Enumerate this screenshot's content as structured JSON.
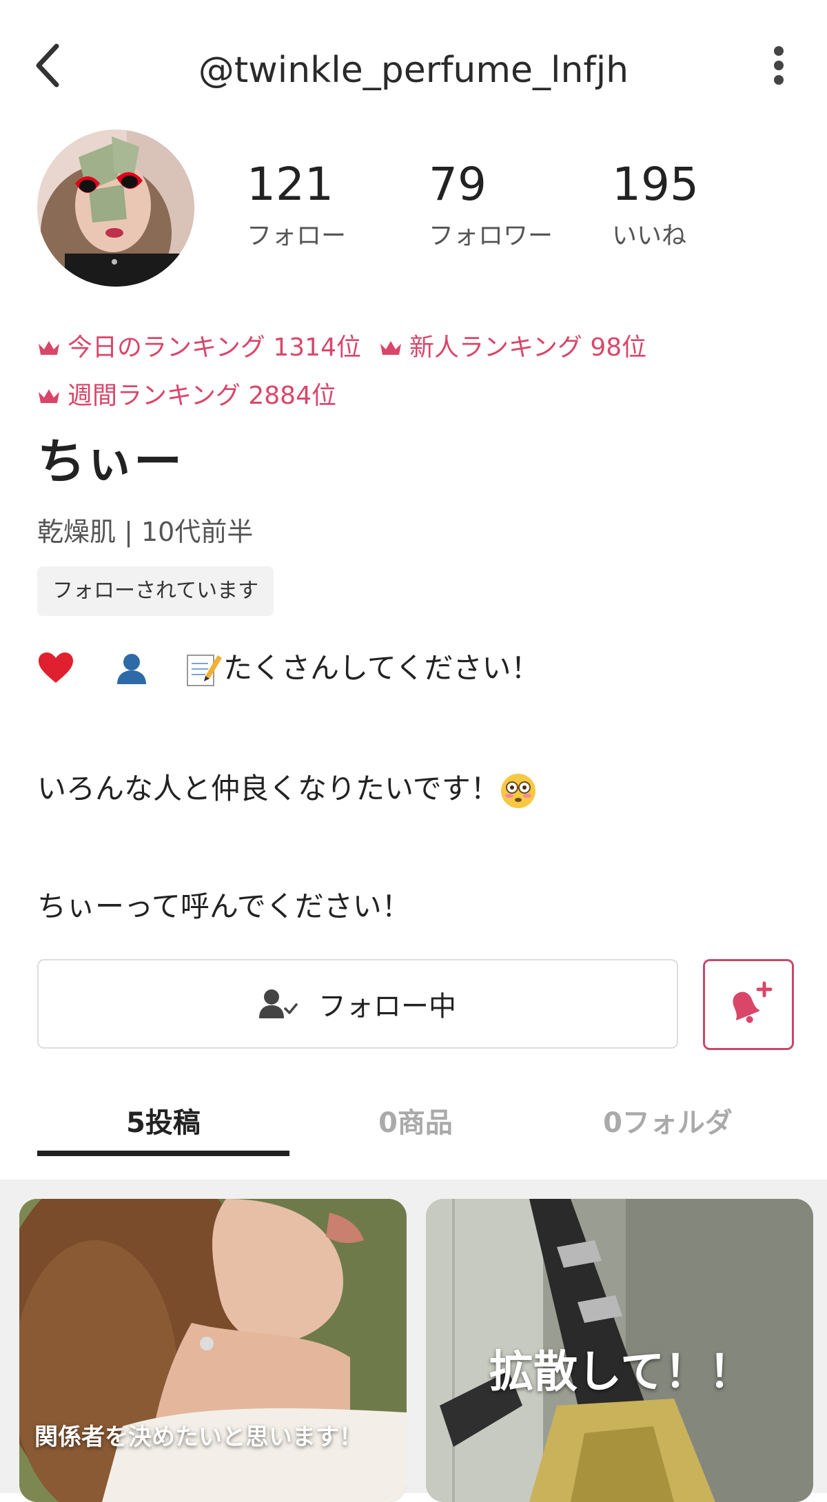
{
  "header": {
    "handle": "@twinkle_perfume_lnfjh"
  },
  "stats": [
    {
      "value": "121",
      "label": "フォロー"
    },
    {
      "value": "79",
      "label": "フォロワー"
    },
    {
      "value": "195",
      "label": "いいね"
    }
  ],
  "rankings": [
    {
      "label": "今日のランキング 1314位"
    },
    {
      "label": "新人ランキング 98位"
    },
    {
      "label": "週間ランキング 2884位"
    }
  ],
  "profile": {
    "name": "ちぃー",
    "attributes": "乾燥肌 | 10代前半",
    "follow_status": "フォローされています"
  },
  "bio": {
    "line1_text": "たくさんしてください！",
    "line2": "いろんな人と仲良くなりたいです！",
    "line3": "ちぃーって呼んでください！",
    "emojis": [
      "heart-emoji",
      "person-emoji",
      "memo-emoji",
      "flushed-face-emoji"
    ]
  },
  "actions": {
    "follow_label": "フォロー中"
  },
  "tabs": [
    {
      "label": "5投稿",
      "active": true
    },
    {
      "label": "0商品",
      "active": false
    },
    {
      "label": "0フォルダ",
      "active": false
    }
  ],
  "posts": [
    {
      "caption": "関係者を決めたいと思います！"
    },
    {
      "caption": "拡散して！！"
    }
  ],
  "colors": {
    "accent": "#d9466a",
    "notify_border": "#c8476a",
    "text_primary": "#222222",
    "text_secondary": "#555555",
    "tab_inactive": "#aaaaaa"
  }
}
